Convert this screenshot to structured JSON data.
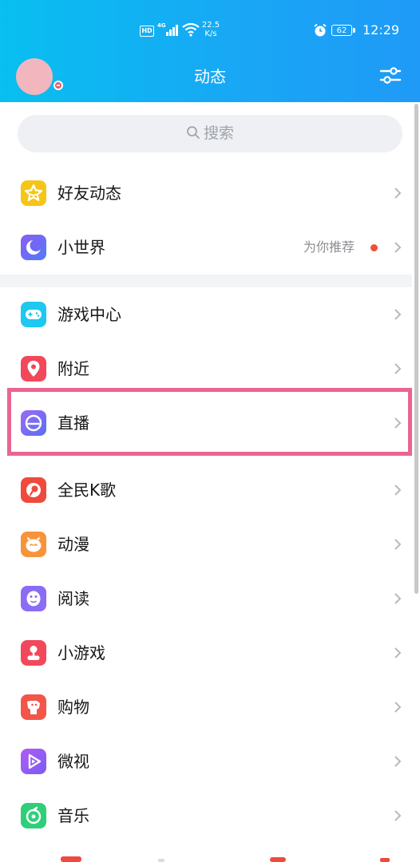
{
  "status_bar": {
    "hd": "HD",
    "network": "4G",
    "speed_value": "22.5",
    "speed_unit": "K/s",
    "battery": "62",
    "time": "12:29"
  },
  "header": {
    "title": "动态",
    "settings_icon": "sliders-icon"
  },
  "search": {
    "placeholder": "搜索",
    "icon": "search-icon"
  },
  "list_group_1": [
    {
      "label": "好友动态",
      "icon": "star-icon",
      "color": "#f5c518"
    },
    {
      "label": "小世界",
      "icon": "crescent-icon",
      "color": "#6a5cf2",
      "extra": "为你推荐",
      "has_dot": true
    }
  ],
  "list_group_2": [
    {
      "label": "游戏中心",
      "icon": "gamepad-icon",
      "color": "#1ec8f0"
    },
    {
      "label": "附近",
      "icon": "location-pin-icon",
      "color": "#f2485b"
    },
    {
      "label": "直播",
      "icon": "live-icon",
      "color": "#7a6cf0",
      "highlighted": true
    },
    {
      "label": "全民K歌",
      "icon": "karaoke-icon",
      "color": "#ef4a3c"
    },
    {
      "label": "动漫",
      "icon": "anime-face-icon",
      "color": "#f7943a"
    },
    {
      "label": "阅读",
      "icon": "penguin-icon",
      "color": "#8a6cf5"
    },
    {
      "label": "小游戏",
      "icon": "joystick-icon",
      "color": "#f2485b"
    },
    {
      "label": "购物",
      "icon": "dog-icon",
      "color": "#f2564a"
    },
    {
      "label": "微视",
      "icon": "play-icon",
      "color": "#9b5cf2"
    },
    {
      "label": "音乐",
      "icon": "music-disc-icon",
      "color": "#2fcf7a"
    }
  ]
}
